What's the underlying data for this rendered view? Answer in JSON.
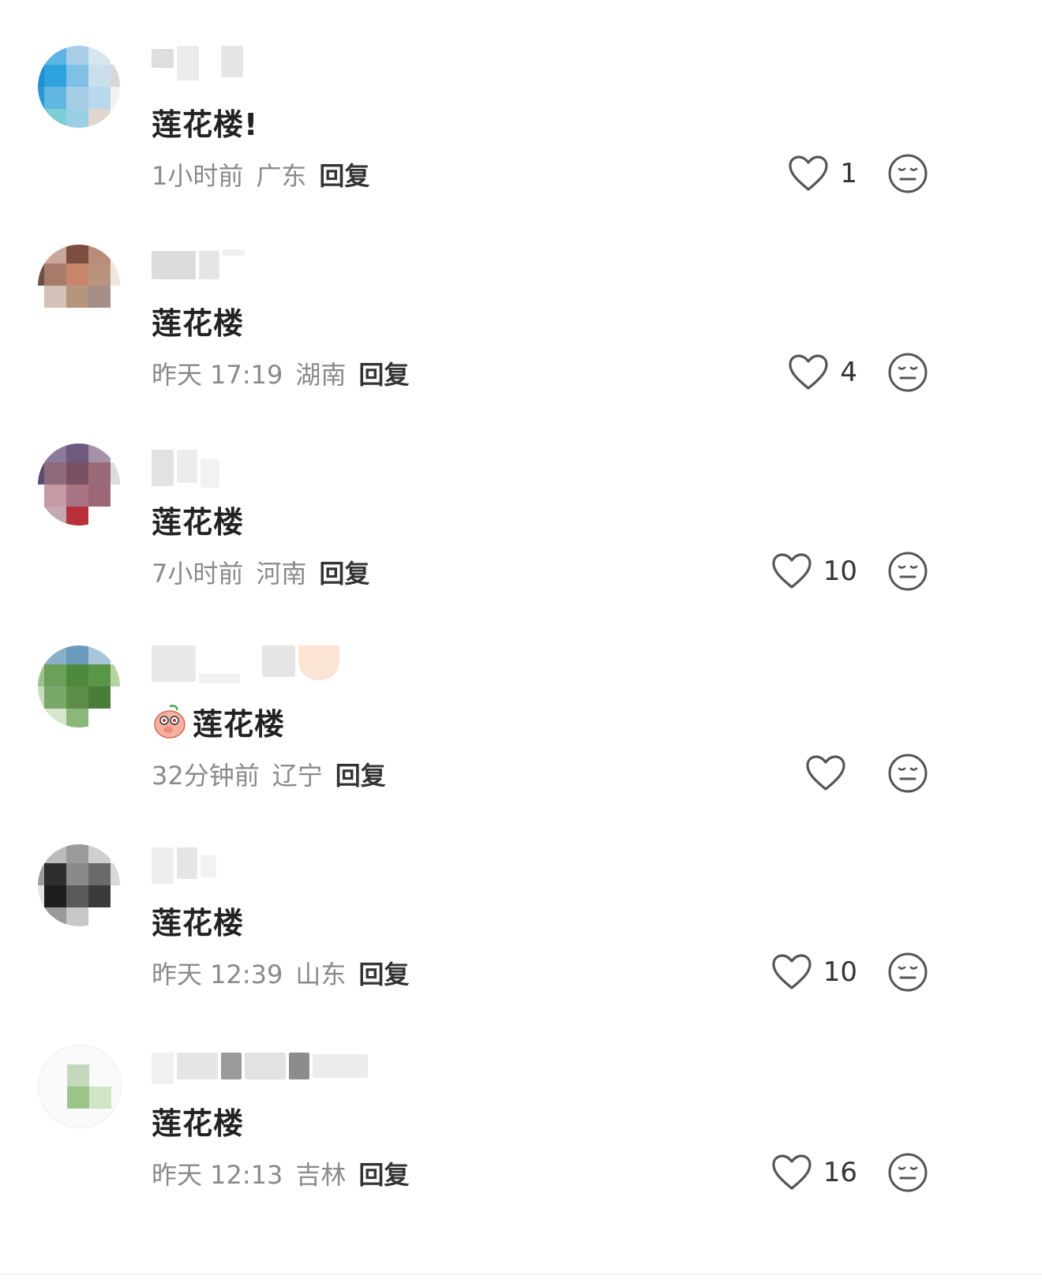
{
  "colors": {
    "text": "#222222",
    "meta": "#8a8a8a",
    "icon": "#555555",
    "background": "#ffffff"
  },
  "comments": [
    {
      "text": "莲花楼!",
      "time": "1小时前",
      "location": "广东",
      "reply": "回复",
      "likes": "1",
      "emoji": ""
    },
    {
      "text": "莲花楼",
      "time": "昨天 17:19",
      "location": "湖南",
      "reply": "回复",
      "likes": "4",
      "emoji": ""
    },
    {
      "text": "莲花楼",
      "time": "7小时前",
      "location": "河南",
      "reply": "回复",
      "likes": "10",
      "emoji": ""
    },
    {
      "text": "莲花楼",
      "time": "32分钟前",
      "location": "辽宁",
      "reply": "回复",
      "likes": "",
      "emoji": "peach-face"
    },
    {
      "text": "莲花楼",
      "time": "昨天 12:39",
      "location": "山东",
      "reply": "回复",
      "likes": "10",
      "emoji": ""
    },
    {
      "text": "莲花楼",
      "time": "昨天 12:13",
      "location": "吉林",
      "reply": "回复",
      "likes": "16",
      "emoji": ""
    }
  ],
  "icons": {
    "like": "heart-outline-icon",
    "dislike": "neutral-face-icon"
  }
}
